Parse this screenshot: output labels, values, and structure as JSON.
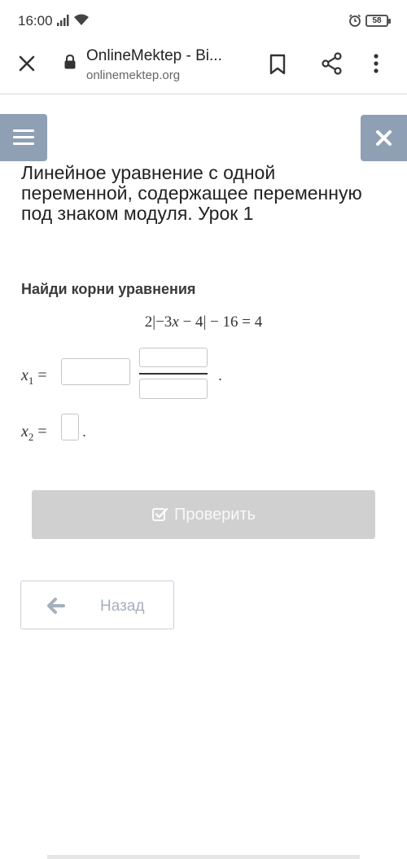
{
  "status_bar": {
    "time": "16:00",
    "battery": "58"
  },
  "browser": {
    "title": "OnlineMektep - Bi...",
    "url": "onlinemektep.org"
  },
  "lesson": {
    "title": "Линейное уравнение с одной переменной, содержащее переменную под знаком модуля. Урок 1"
  },
  "task": {
    "heading": "Найди корни уравнения",
    "equation": {
      "coef": "2",
      "abs_left": "|−3",
      "var": "x",
      "abs_right": " − 4| − 16 = 4"
    },
    "x1": {
      "var": "x",
      "sub": "1",
      "eq": " =",
      "whole": "",
      "numerator": "",
      "denominator": "",
      "dot": "."
    },
    "x2": {
      "var": "x",
      "sub": "2",
      "eq": " =",
      "value": "",
      "dot": "."
    }
  },
  "buttons": {
    "check": "Проверить",
    "back": "Назад"
  },
  "colors": {
    "overlay_button": "#8fa0b5",
    "check_button_disabled": "#d0d0d0",
    "back_border": "#c8d0da",
    "back_text": "#a5b0be"
  },
  "icons": [
    "signal-icon",
    "wifi-icon",
    "alarm-icon",
    "close-icon",
    "lock-icon",
    "bookmark-icon",
    "share-icon",
    "more-icon",
    "menu-icon",
    "x-icon",
    "check-square-icon",
    "arrow-left-icon"
  ]
}
